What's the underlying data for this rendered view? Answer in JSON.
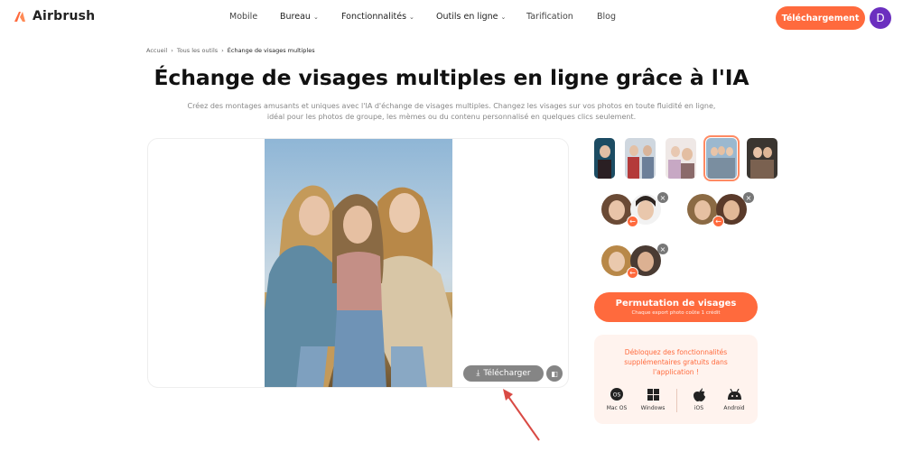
{
  "brand": {
    "name": "Airbrush",
    "accent": "#ff6a3d"
  },
  "nav": {
    "items": [
      {
        "label": "Mobile",
        "dropdown": false
      },
      {
        "label": "Bureau",
        "dropdown": true
      },
      {
        "label": "Fonctionnalités",
        "dropdown": true
      },
      {
        "label": "Outils en ligne",
        "dropdown": true
      },
      {
        "label": "Tarification",
        "dropdown": false
      },
      {
        "label": "Blog",
        "dropdown": false
      }
    ],
    "download_label": "Téléchargement",
    "avatar_letter": "D"
  },
  "breadcrumb": {
    "home": "Accueil",
    "tools": "Tous les outils",
    "current": "Échange de visages multiples"
  },
  "page": {
    "title": "Échange de visages multiples en ligne grâce à l'IA",
    "subtitle_line1": "Créez des montages amusants et uniques avec l'IA d'échange de visages multiples. Changez les visages sur vos photos en toute fluidité en ligne,",
    "subtitle_line2": "idéal pour les photos de groupe, les mèmes ou du contenu personnalisé en quelques clics seulement."
  },
  "editor": {
    "download_label": "Télécharger"
  },
  "sidebar": {
    "cta_label": "Permutation de visages",
    "cta_sub": "Chaque export photo coûte 1 crédit",
    "promo_line1": "Débloquez des fonctionnalités",
    "promo_line2": "supplémentaires gratuits dans",
    "promo_line3": "l'application !",
    "platforms": [
      {
        "label": "Mac OS",
        "icon": "macos-icon"
      },
      {
        "label": "Windows",
        "icon": "windows-icon"
      },
      {
        "label": "iOS",
        "icon": "apple-icon"
      },
      {
        "label": "Android",
        "icon": "android-icon"
      }
    ]
  }
}
